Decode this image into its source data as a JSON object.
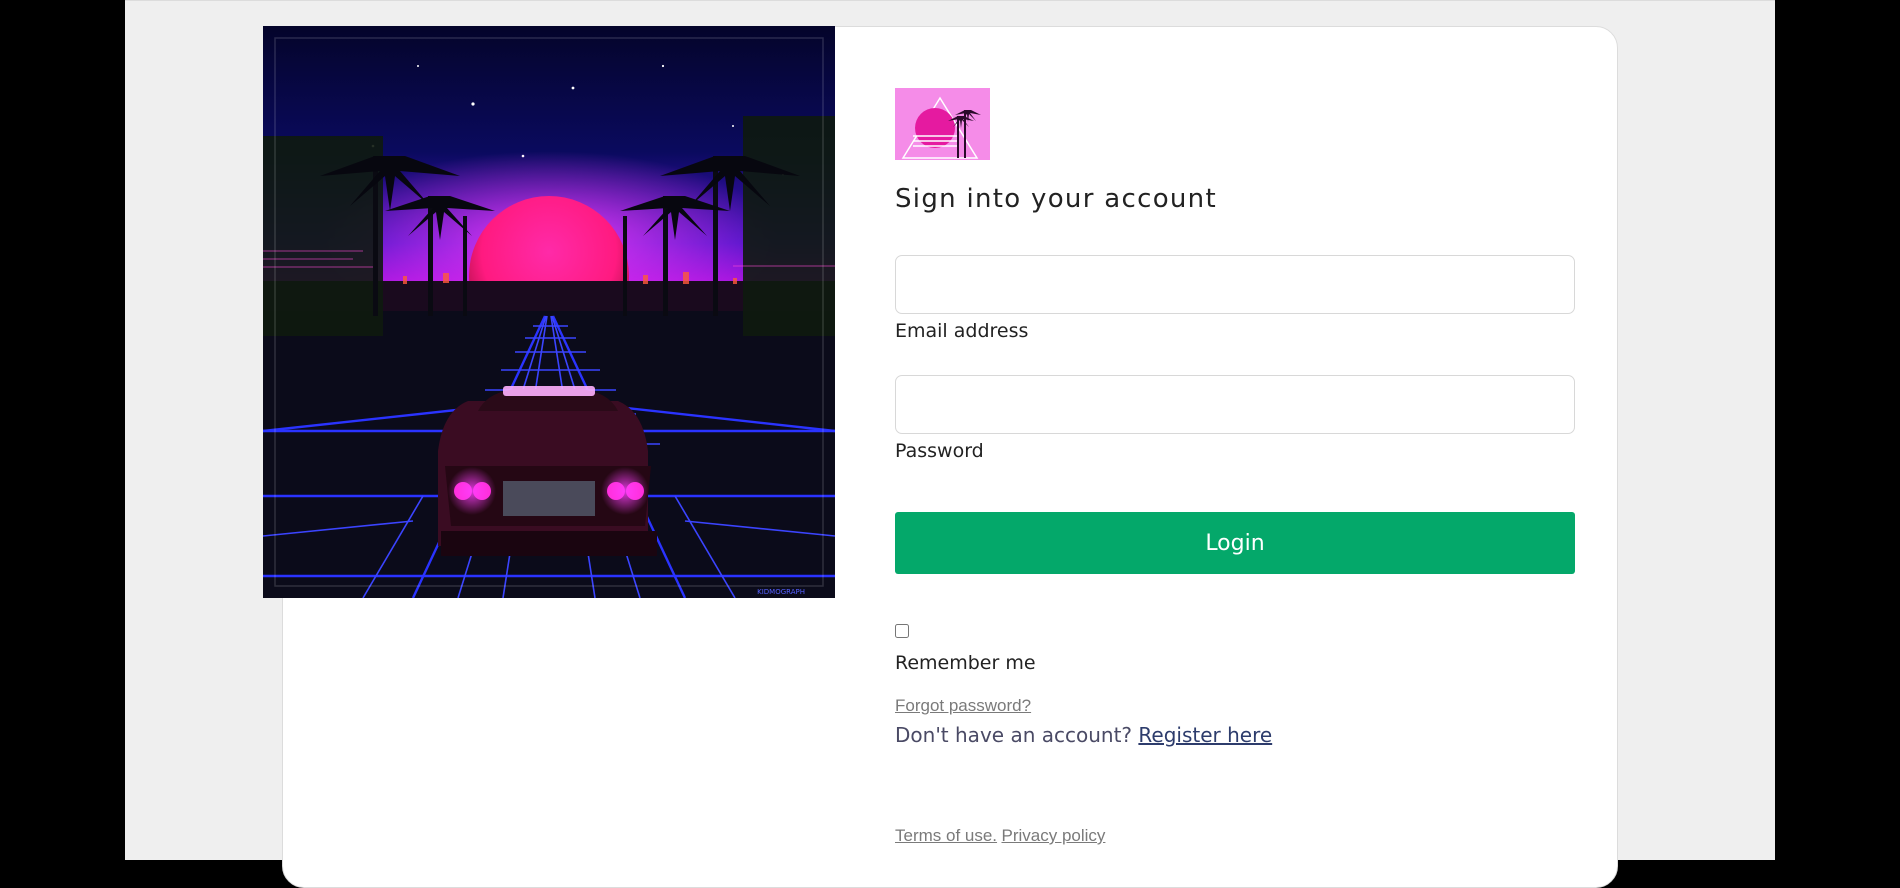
{
  "form": {
    "title": "Sign into your account",
    "email_label": "Email address",
    "email_value": "",
    "password_label": "Password",
    "password_value": "",
    "login_label": "Login",
    "remember_label": "Remember me",
    "remember_checked": false,
    "forgot_label": "Forgot password?",
    "no_account_text": "Don't have an account?",
    "register_label": "Register here"
  },
  "footer": {
    "terms_label": "Terms of use.",
    "privacy_label": "Privacy policy"
  },
  "hero": {
    "watermark": "KIDMOGRAPH"
  },
  "colors": {
    "accent": "#04a86a",
    "page_background": "#efefef",
    "card_background": "#ffffff",
    "outer_background": "#000000",
    "logo_pink": "#f58ce8"
  }
}
